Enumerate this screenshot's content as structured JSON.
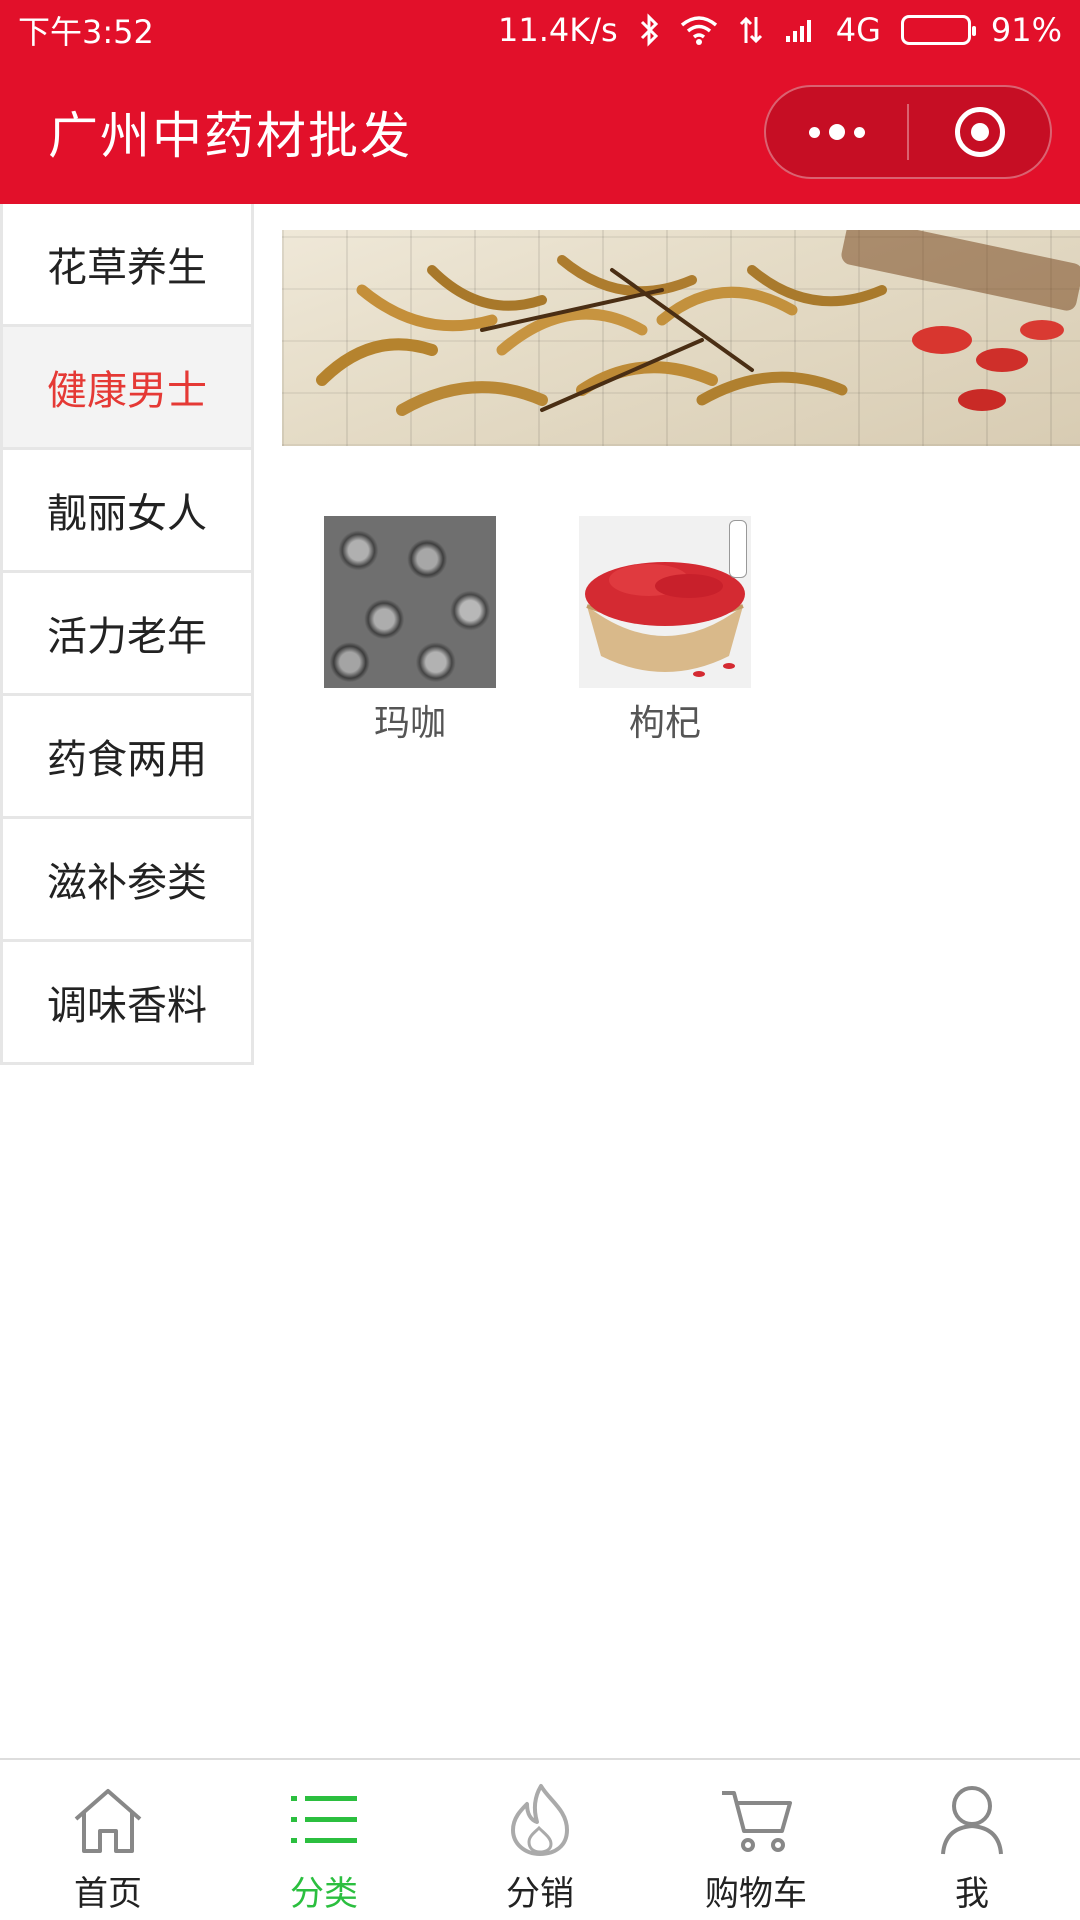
{
  "status_bar": {
    "time": "下午3:52",
    "net_speed": "11.4K/s",
    "network": "4G",
    "battery": "91%"
  },
  "header": {
    "title": "广州中药材批发",
    "menu_icon": "more-dots-icon",
    "close_icon": "target-close-icon",
    "bg_color": "#e2102a"
  },
  "sidebar": {
    "items": [
      {
        "label": "花草养生"
      },
      {
        "label": "健康男士"
      },
      {
        "label": "靓丽女人"
      },
      {
        "label": "活力老年"
      },
      {
        "label": "药食两用"
      },
      {
        "label": "滋补参类"
      },
      {
        "label": "调味香料"
      }
    ],
    "active_index": 1,
    "active_color": "#e53935"
  },
  "products": [
    {
      "name": "玛咖",
      "icon": "maca-product-image"
    },
    {
      "name": "枸杞",
      "icon": "goji-product-image"
    }
  ],
  "tabbar": {
    "items": [
      {
        "label": "首页",
        "icon": "home-icon"
      },
      {
        "label": "分类",
        "icon": "category-list-icon"
      },
      {
        "label": "分销",
        "icon": "flame-icon"
      },
      {
        "label": "购物车",
        "icon": "cart-icon"
      },
      {
        "label": "我",
        "icon": "user-icon"
      }
    ],
    "active_index": 1,
    "active_color": "#2bbf3f"
  }
}
